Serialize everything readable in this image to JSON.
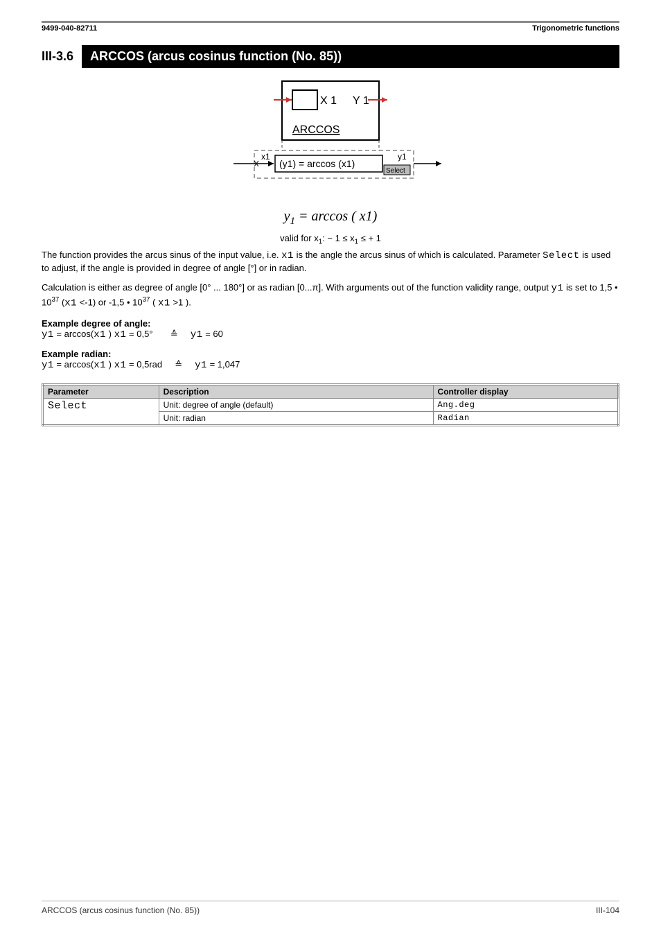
{
  "header": {
    "left": "9499-040-82711",
    "right": "Trigonometric functions"
  },
  "section": {
    "number": "III-3.6",
    "title": "ARCCOS (arcus cosinus function (No. 85))"
  },
  "diagram": {
    "block_x": "X 1",
    "block_y": "Y 1",
    "block_name": "ARCCOS",
    "port_in": "x1",
    "port_out": "y1",
    "equation_box": "(y1) = arccos (x1)",
    "select_label": "Select"
  },
  "formula": {
    "lhs": "y",
    "lhs_sub": "1",
    "eq": " = ",
    "func": "arccos",
    "open": " ( x",
    "arg_sub_close_html": "1)"
  },
  "valid": {
    "prefix": "valid   for x",
    "sub": "1",
    "cond": ": − 1 ≤ x",
    "sub2": "1",
    "tail": " ≤ + 1"
  },
  "body": {
    "p1a": "The function provides the arcus sinus of the input value, i.e. ",
    "p1_x1": "x1",
    "p1b": " is the angle the arcus sinus of which is calculated. Parameter ",
    "p1_select": "Select",
    "p1c": " is used to adjust, if the angle is provided in degree of angle [°] or in radian.",
    "p2a": "Calculation is either as degree of angle [0° ... 180°] or as radian  [0...",
    "p2_pi": "π",
    "p2b": "]. With arguments out of the function validity range, output ",
    "p2_y1": "y1",
    "p2c": " is set to 1,5 • 10",
    "p2_exp": "37",
    "p2d": " (",
    "p2_x1": "x1",
    "p2e": " <-1)  or -1,5 • 10",
    "p2_exp2": "37",
    "p2f": " ( ",
    "p2_x1b": "x1",
    "p2g": " >1 )."
  },
  "examples": {
    "deg_title": "Example degree of angle:",
    "deg_y1": "y1",
    "deg_a": " = arccos(",
    "deg_x1": "x1",
    "deg_b": " )  ",
    "deg_x1b": "x1",
    "deg_c": " = 0,5°",
    "deg_sym": "≙",
    "deg_y1b": "y1",
    "deg_res": " = 60",
    "rad_title": "Example radian:",
    "rad_y1": "y1",
    "rad_a": " = arccos(",
    "rad_x1": "x1",
    "rad_b": " )  ",
    "rad_x1b": "x1",
    "rad_c": " = 0,5rad",
    "rad_sym": "≙",
    "rad_y1b": "y1",
    "rad_res": " = 1,047"
  },
  "table": {
    "h1": "Parameter",
    "h2": "Description",
    "h3": "Controller display",
    "r1c1": "Select",
    "r1c2": "Unit: degree of angle (default)",
    "r1c3": "Ang.deg",
    "r2c2": "Unit: radian",
    "r2c3": "Radian"
  },
  "footer": {
    "left": "ARCCOS (arcus cosinus function (No. 85))",
    "right": "III-104"
  }
}
